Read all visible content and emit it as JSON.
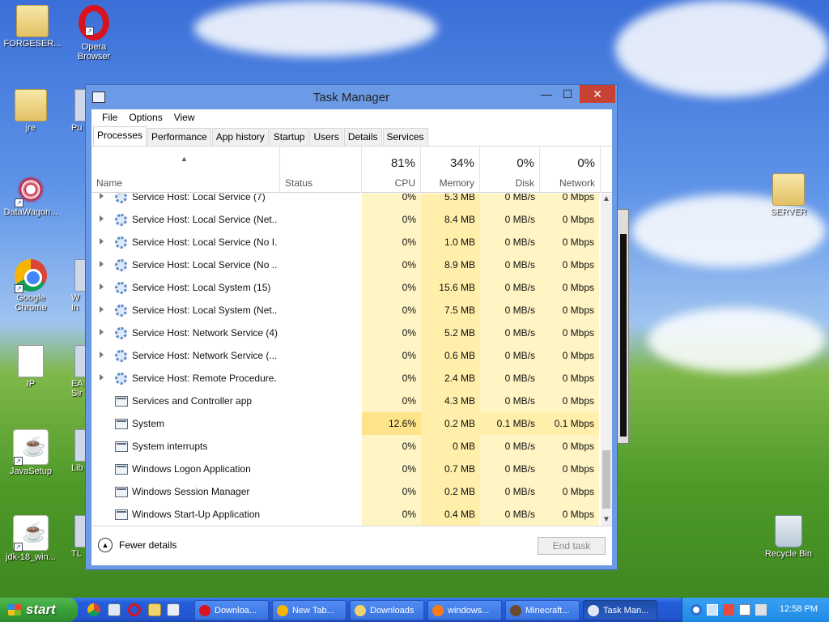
{
  "desktop": {
    "icons": [
      {
        "label": "FORGESER...",
        "kind": "folder"
      },
      {
        "label": "Opera\nBrowser",
        "kind": "opera"
      },
      {
        "label": "jre",
        "kind": "folder"
      },
      {
        "label": "DataWagon...",
        "kind": "datawagon"
      },
      {
        "label": "Google\nChrome",
        "kind": "chrome"
      },
      {
        "label": "IP",
        "kind": "doc"
      },
      {
        "label": "JavaSetup",
        "kind": "java"
      },
      {
        "label": "jdk-18_win...",
        "kind": "java"
      },
      {
        "label": "SERVER",
        "kind": "folder"
      },
      {
        "label": "Recycle Bin",
        "kind": "recycle-bin"
      }
    ],
    "partial_labels": [
      "Pu",
      "W\nIn",
      "EA\nSir",
      "Lib",
      "TL"
    ]
  },
  "task_manager": {
    "title": "Task Manager",
    "controls": {
      "minimize": "—",
      "maximize": "☐",
      "close": "✕"
    },
    "menu": [
      "File",
      "Options",
      "View"
    ],
    "tabs": [
      "Processes",
      "Performance",
      "App history",
      "Startup",
      "Users",
      "Details",
      "Services"
    ],
    "active_tab": "Processes",
    "columns": {
      "name": "Name",
      "status": "Status",
      "cpu": {
        "percent": "81%",
        "label": "CPU"
      },
      "memory": {
        "percent": "34%",
        "label": "Memory"
      },
      "disk": {
        "percent": "0%",
        "label": "Disk"
      },
      "network": {
        "percent": "0%",
        "label": "Network"
      }
    },
    "rows": [
      {
        "name": "Service Host: Local Service (7)",
        "cpu": "0%",
        "mem": "5.3 MB",
        "disk": "0 MB/s",
        "net": "0 Mbps",
        "expand": true,
        "icon": "gear"
      },
      {
        "name": "Service Host: Local Service (Net...",
        "cpu": "0%",
        "mem": "8.4 MB",
        "disk": "0 MB/s",
        "net": "0 Mbps",
        "expand": true,
        "icon": "gear"
      },
      {
        "name": "Service Host: Local Service (No I...",
        "cpu": "0%",
        "mem": "1.0 MB",
        "disk": "0 MB/s",
        "net": "0 Mbps",
        "expand": true,
        "icon": "gear"
      },
      {
        "name": "Service Host: Local Service (No ...",
        "cpu": "0%",
        "mem": "8.9 MB",
        "disk": "0 MB/s",
        "net": "0 Mbps",
        "expand": true,
        "icon": "gear"
      },
      {
        "name": "Service Host: Local System (15)",
        "cpu": "0%",
        "mem": "15.6 MB",
        "disk": "0 MB/s",
        "net": "0 Mbps",
        "expand": true,
        "icon": "gear"
      },
      {
        "name": "Service Host: Local System (Net...",
        "cpu": "0%",
        "mem": "7.5 MB",
        "disk": "0 MB/s",
        "net": "0 Mbps",
        "expand": true,
        "icon": "gear"
      },
      {
        "name": "Service Host: Network Service (4)",
        "cpu": "0%",
        "mem": "5.2 MB",
        "disk": "0 MB/s",
        "net": "0 Mbps",
        "expand": true,
        "icon": "gear"
      },
      {
        "name": "Service Host: Network Service (...",
        "cpu": "0%",
        "mem": "0.6 MB",
        "disk": "0 MB/s",
        "net": "0 Mbps",
        "expand": true,
        "icon": "gear"
      },
      {
        "name": "Service Host: Remote Procedure...",
        "cpu": "0%",
        "mem": "2.4 MB",
        "disk": "0 MB/s",
        "net": "0 Mbps",
        "expand": true,
        "icon": "gear"
      },
      {
        "name": "Services and Controller app",
        "cpu": "0%",
        "mem": "4.3 MB",
        "disk": "0 MB/s",
        "net": "0 Mbps",
        "expand": false,
        "icon": "app"
      },
      {
        "name": "System",
        "cpu": "12.6%",
        "mem": "0.2 MB",
        "disk": "0.1 MB/s",
        "net": "0.1 Mbps",
        "expand": false,
        "icon": "app",
        "hot": true
      },
      {
        "name": "System interrupts",
        "cpu": "0%",
        "mem": "0 MB",
        "disk": "0 MB/s",
        "net": "0 Mbps",
        "expand": false,
        "icon": "app"
      },
      {
        "name": "Windows Logon Application",
        "cpu": "0%",
        "mem": "0.7 MB",
        "disk": "0 MB/s",
        "net": "0 Mbps",
        "expand": false,
        "icon": "app"
      },
      {
        "name": "Windows Session Manager",
        "cpu": "0%",
        "mem": "0.2 MB",
        "disk": "0 MB/s",
        "net": "0 Mbps",
        "expand": false,
        "icon": "app"
      },
      {
        "name": "Windows Start-Up Application",
        "cpu": "0%",
        "mem": "0.4 MB",
        "disk": "0 MB/s",
        "net": "0 Mbps",
        "expand": false,
        "icon": "app"
      }
    ],
    "footer": {
      "fewer_details": "Fewer details",
      "end_task": "End task"
    }
  },
  "taskbar": {
    "start_label": "start",
    "items": [
      {
        "label": "Downloa...",
        "icon": "opera-icon",
        "color": "#d8131f"
      },
      {
        "label": "New Tab...",
        "icon": "chrome-icon",
        "color": "#f4b400"
      },
      {
        "label": "Downloads",
        "icon": "folder-icon",
        "color": "#f1d36b"
      },
      {
        "label": "windows...",
        "icon": "firefox-icon",
        "color": "#ff7b16"
      },
      {
        "label": "Minecraft...",
        "icon": "minecraft-icon",
        "color": "#6b4a2b"
      },
      {
        "label": "Task Man...",
        "icon": "task-manager-icon",
        "color": "#dfe8f5",
        "active": true
      }
    ],
    "clock": "12:58 PM"
  }
}
